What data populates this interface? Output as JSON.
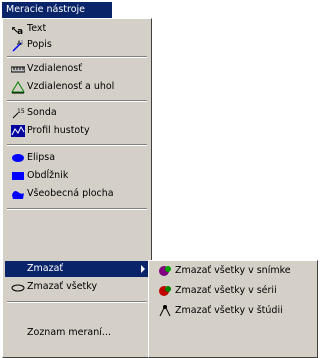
{
  "menu_title": "Meracie nástroje",
  "items": [
    {
      "label": "Text",
      "icon": "text-annotation-icon"
    },
    {
      "label": "Popis",
      "icon": "arrow-annotation-icon"
    },
    {
      "label": "Vzdialenosť",
      "icon": "ruler-icon"
    },
    {
      "label": "Vzdialenosť a uhol",
      "icon": "angle-icon"
    },
    {
      "label": "Sonda",
      "icon": "probe-icon"
    },
    {
      "label": "Profil hustoty",
      "icon": "density-profile-icon"
    },
    {
      "label": "Elipsa",
      "icon": "ellipse-icon"
    },
    {
      "label": "Obdĺžnik",
      "icon": "rectangle-icon"
    },
    {
      "label": "Všeobecná plocha",
      "icon": "freeform-area-icon"
    },
    {
      "label": "Zmazať",
      "icon": ""
    },
    {
      "label": "Zmazať všetky",
      "icon": "eraser-icon"
    },
    {
      "label": "Zoznam meraní...",
      "icon": ""
    }
  ],
  "submenu": [
    {
      "label": "Zmazať všetky v snímke",
      "icon": "delete-image-icon"
    },
    {
      "label": "Zmazať všetky v sérii",
      "icon": "delete-series-icon"
    },
    {
      "label": "Zmazať všetky v štúdii",
      "icon": "delete-study-icon"
    }
  ]
}
